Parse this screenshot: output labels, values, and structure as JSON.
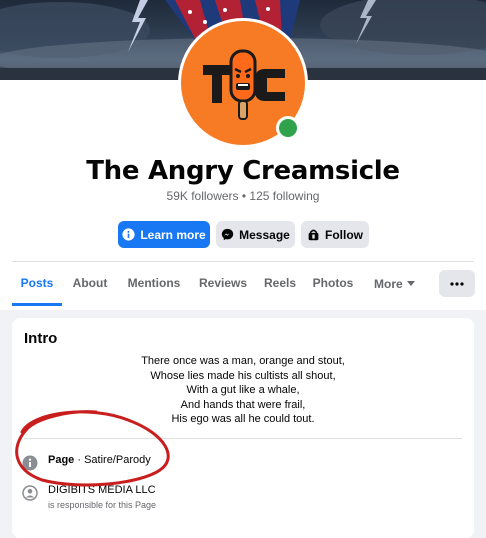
{
  "profile": {
    "name": "The Angry Creamsicle",
    "stats": "59K followers • 125 following",
    "logo_text": "TAC"
  },
  "actions": {
    "learn_more": "Learn more",
    "message": "Message",
    "follow": "Follow"
  },
  "tabs": [
    {
      "label": "Posts",
      "active": true
    },
    {
      "label": "About"
    },
    {
      "label": "Mentions"
    },
    {
      "label": "Reviews"
    },
    {
      "label": "Reels"
    },
    {
      "label": "Photos"
    },
    {
      "label": "More"
    }
  ],
  "intro": {
    "title": "Intro",
    "bio_lines": [
      "There once was a man, orange and stout,",
      "Whose lies made his cultists all shout,",
      "With a gut like a whale,",
      "And hands that were frail,",
      "His ego was all he could tout."
    ],
    "category_label": "Page",
    "category_value": " · Satire/Parody",
    "owner_name": "DIGIBITS MEDIA LLC",
    "owner_sub": "is responsible for this Page"
  },
  "colors": {
    "accent": "#1877f2",
    "avatar_bg": "#f77b24",
    "online": "#31a24c",
    "annotation": "#c81e1e"
  }
}
